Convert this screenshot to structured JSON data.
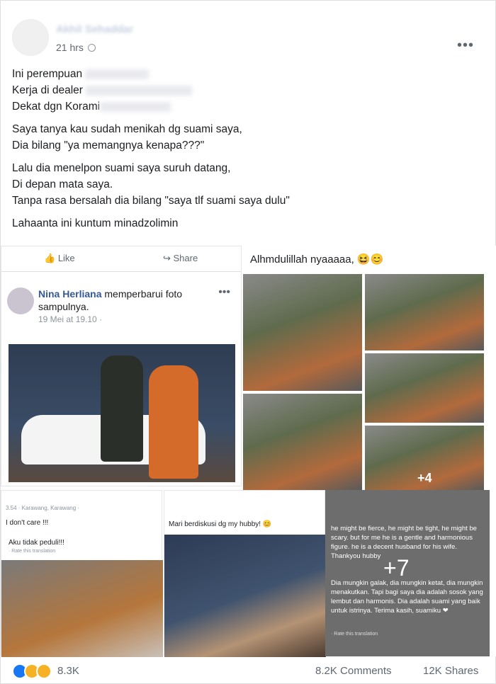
{
  "header": {
    "author_blurred": "Akhil Sehaddar",
    "time": "21 hrs",
    "menu_icon": "more-dots-icon"
  },
  "post": {
    "p1": [
      "Ini perempuan",
      "Kerja di dealer",
      "Dekat dgn Korami"
    ],
    "p2": [
      "Saya tanya kau sudah menikah dg suami saya,",
      "Dia bilang \"ya memangnya kenapa???\""
    ],
    "p3": [
      "Lalu dia menelpon suami saya suruh datang,",
      "Di depan mata saya.",
      "Tanpa rasa bersalah dia bilang \"saya tlf suami saya dulu\""
    ],
    "p4": "Lahaanta ini kuntum minadzolimin"
  },
  "collage": {
    "ss1": {
      "like": "Like",
      "share": "Share",
      "name": "Nina Herliana",
      "action": " memperbarui foto sampulnya.",
      "time": "19 Mei at 19.10"
    },
    "ss2": {
      "caption": "Alhmdulillah nyaaaaa, 😆😊",
      "plus": "+4"
    },
    "ss3": {
      "meta": "3.54 · Karawang, Karawang ·",
      "line1": "I don't care !!!",
      "line2": "Aku tidak peduli!!!",
      "line3": "· Rate this translation"
    },
    "ss4": {
      "line1": "Mari berdiskusi dg my hubby! 😊"
    },
    "ss5": {
      "text_en": "he might be fierce, he might be tight, he might be scary. but for me he is a gentle and harmonious figure. he is a decent husband for his wife. Thankyou hubby",
      "text_id": "Dia mungkin galak, dia mungkin ketat, dia mungkin menakutkan. Tapi bagi saya dia adalah sosok yang lembut dan harmonis. Dia adalah suami yang baik untuk istrinya. Terima kasih, suamiku ❤",
      "rate": "· Rate this translation",
      "plus": "+7"
    }
  },
  "footer": {
    "reaction_count": "8.3K",
    "comments": "8.2K Comments",
    "shares": "12K Shares"
  }
}
